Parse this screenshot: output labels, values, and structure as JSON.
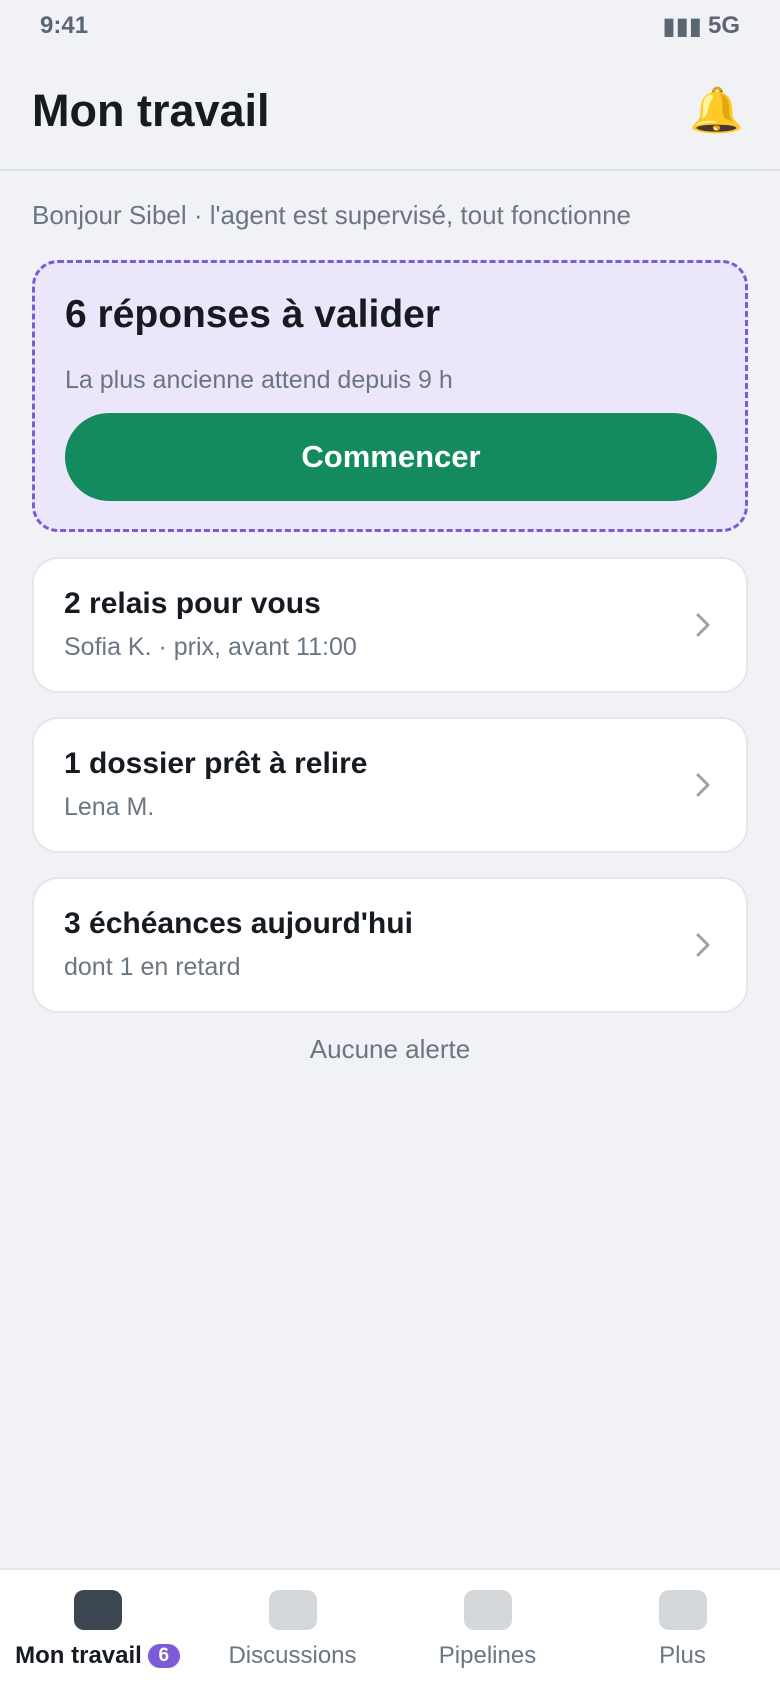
{
  "status_bar": {
    "time": "9:41",
    "signal": "▮▮▮",
    "network": "5G"
  },
  "header": {
    "title": "Mon travail",
    "bell_icon": "🔔"
  },
  "greeting": "Bonjour Sibel · l'agent est supervisé, tout fonctionne",
  "validation_card": {
    "title": "6 réponses à valider",
    "subtitle": "La plus ancienne attend depuis 9 h",
    "button_label": "Commencer"
  },
  "cards": [
    {
      "title": "2 relais pour vous",
      "subtitle": "Sofia K. · prix, avant 11:00"
    },
    {
      "title": "1 dossier prêt à relire",
      "subtitle": "Lena M."
    },
    {
      "title": "3 échéances aujourd'hui",
      "subtitle": "dont 1 en retard"
    }
  ],
  "no_alert": "Aucune alerte",
  "bottom_nav": {
    "items": [
      {
        "label": "Mon travail",
        "badge": "6",
        "active": true
      },
      {
        "label": "Discussions"
      },
      {
        "label": "Pipelines"
      },
      {
        "label": "Plus"
      }
    ]
  },
  "colors": {
    "accent_purple": "#7b5bd6",
    "primary_green": "#138b5f",
    "card_tint": "#ebe6fa",
    "background": "#f0f2f5"
  }
}
